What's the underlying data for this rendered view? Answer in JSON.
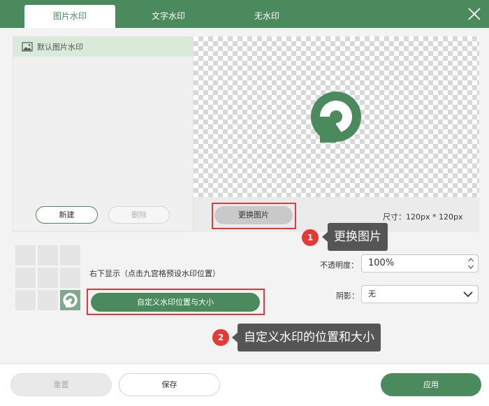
{
  "tabs": [
    {
      "label": "图片水印",
      "active": true
    },
    {
      "label": "文字水印",
      "active": false
    },
    {
      "label": "无水印",
      "active": false
    }
  ],
  "icons": {
    "close": "close-icon",
    "image": "image-icon",
    "logo": "green-r-logo",
    "spinner": "spinner-arrows-icon",
    "dropdown": "chevron-down-icon"
  },
  "colors": {
    "brand": "#4a8a5c",
    "highlight": "#e53935",
    "callout": "#555555"
  },
  "list": {
    "items": [
      {
        "label": "默认图片水印",
        "selected": true
      }
    ]
  },
  "left_buttons": {
    "new": "新建",
    "delete": "删除"
  },
  "preview": {
    "replace_label": "更换图片",
    "size_text": "尺寸：120px * 120px"
  },
  "position": {
    "text": "右下显示（点击九宫格预设水印位置）",
    "custom_label": "自定义水印位置与大小",
    "selected_cell": "bottom-right"
  },
  "opacity": {
    "label": "不透明度：",
    "value": "100%"
  },
  "shadow": {
    "label": "阴影：",
    "value": "无"
  },
  "callouts": [
    {
      "num": "1",
      "text": "更换图片"
    },
    {
      "num": "2",
      "text": "自定义水印的位置和大小"
    }
  ],
  "footer": {
    "reset": "重置",
    "save": "保存",
    "apply": "应用"
  }
}
